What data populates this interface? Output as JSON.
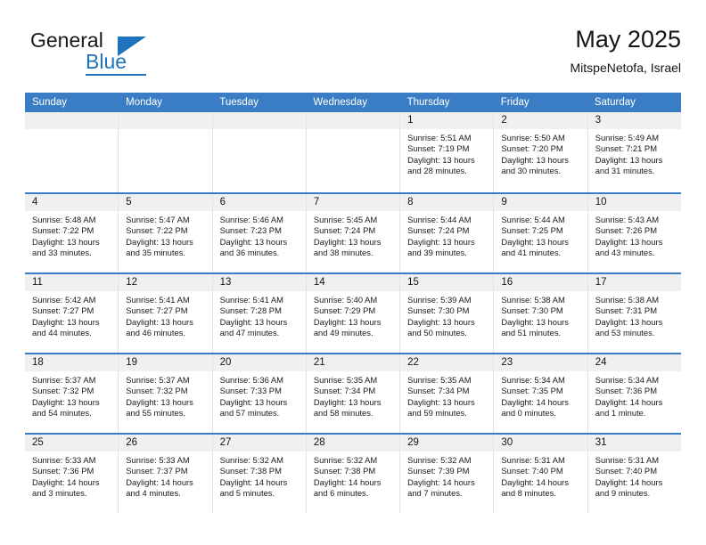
{
  "brand": {
    "name_part1": "General",
    "name_part2": "Blue",
    "accent_color": "#1F72BD"
  },
  "header": {
    "title": "May 2025",
    "subtitle": "MitspeNetofa, Israel"
  },
  "calendar": {
    "header_color": "#3B7DC4",
    "weekdays": [
      "Sunday",
      "Monday",
      "Tuesday",
      "Wednesday",
      "Thursday",
      "Friday",
      "Saturday"
    ],
    "weeks": [
      [
        {
          "day": "",
          "lines": []
        },
        {
          "day": "",
          "lines": []
        },
        {
          "day": "",
          "lines": []
        },
        {
          "day": "",
          "lines": []
        },
        {
          "day": "1",
          "lines": [
            "Sunrise: 5:51 AM",
            "Sunset: 7:19 PM",
            "Daylight: 13 hours",
            "and 28 minutes."
          ]
        },
        {
          "day": "2",
          "lines": [
            "Sunrise: 5:50 AM",
            "Sunset: 7:20 PM",
            "Daylight: 13 hours",
            "and 30 minutes."
          ]
        },
        {
          "day": "3",
          "lines": [
            "Sunrise: 5:49 AM",
            "Sunset: 7:21 PM",
            "Daylight: 13 hours",
            "and 31 minutes."
          ]
        }
      ],
      [
        {
          "day": "4",
          "lines": [
            "Sunrise: 5:48 AM",
            "Sunset: 7:22 PM",
            "Daylight: 13 hours",
            "and 33 minutes."
          ]
        },
        {
          "day": "5",
          "lines": [
            "Sunrise: 5:47 AM",
            "Sunset: 7:22 PM",
            "Daylight: 13 hours",
            "and 35 minutes."
          ]
        },
        {
          "day": "6",
          "lines": [
            "Sunrise: 5:46 AM",
            "Sunset: 7:23 PM",
            "Daylight: 13 hours",
            "and 36 minutes."
          ]
        },
        {
          "day": "7",
          "lines": [
            "Sunrise: 5:45 AM",
            "Sunset: 7:24 PM",
            "Daylight: 13 hours",
            "and 38 minutes."
          ]
        },
        {
          "day": "8",
          "lines": [
            "Sunrise: 5:44 AM",
            "Sunset: 7:24 PM",
            "Daylight: 13 hours",
            "and 39 minutes."
          ]
        },
        {
          "day": "9",
          "lines": [
            "Sunrise: 5:44 AM",
            "Sunset: 7:25 PM",
            "Daylight: 13 hours",
            "and 41 minutes."
          ]
        },
        {
          "day": "10",
          "lines": [
            "Sunrise: 5:43 AM",
            "Sunset: 7:26 PM",
            "Daylight: 13 hours",
            "and 43 minutes."
          ]
        }
      ],
      [
        {
          "day": "11",
          "lines": [
            "Sunrise: 5:42 AM",
            "Sunset: 7:27 PM",
            "Daylight: 13 hours",
            "and 44 minutes."
          ]
        },
        {
          "day": "12",
          "lines": [
            "Sunrise: 5:41 AM",
            "Sunset: 7:27 PM",
            "Daylight: 13 hours",
            "and 46 minutes."
          ]
        },
        {
          "day": "13",
          "lines": [
            "Sunrise: 5:41 AM",
            "Sunset: 7:28 PM",
            "Daylight: 13 hours",
            "and 47 minutes."
          ]
        },
        {
          "day": "14",
          "lines": [
            "Sunrise: 5:40 AM",
            "Sunset: 7:29 PM",
            "Daylight: 13 hours",
            "and 49 minutes."
          ]
        },
        {
          "day": "15",
          "lines": [
            "Sunrise: 5:39 AM",
            "Sunset: 7:30 PM",
            "Daylight: 13 hours",
            "and 50 minutes."
          ]
        },
        {
          "day": "16",
          "lines": [
            "Sunrise: 5:38 AM",
            "Sunset: 7:30 PM",
            "Daylight: 13 hours",
            "and 51 minutes."
          ]
        },
        {
          "day": "17",
          "lines": [
            "Sunrise: 5:38 AM",
            "Sunset: 7:31 PM",
            "Daylight: 13 hours",
            "and 53 minutes."
          ]
        }
      ],
      [
        {
          "day": "18",
          "lines": [
            "Sunrise: 5:37 AM",
            "Sunset: 7:32 PM",
            "Daylight: 13 hours",
            "and 54 minutes."
          ]
        },
        {
          "day": "19",
          "lines": [
            "Sunrise: 5:37 AM",
            "Sunset: 7:32 PM",
            "Daylight: 13 hours",
            "and 55 minutes."
          ]
        },
        {
          "day": "20",
          "lines": [
            "Sunrise: 5:36 AM",
            "Sunset: 7:33 PM",
            "Daylight: 13 hours",
            "and 57 minutes."
          ]
        },
        {
          "day": "21",
          "lines": [
            "Sunrise: 5:35 AM",
            "Sunset: 7:34 PM",
            "Daylight: 13 hours",
            "and 58 minutes."
          ]
        },
        {
          "day": "22",
          "lines": [
            "Sunrise: 5:35 AM",
            "Sunset: 7:34 PM",
            "Daylight: 13 hours",
            "and 59 minutes."
          ]
        },
        {
          "day": "23",
          "lines": [
            "Sunrise: 5:34 AM",
            "Sunset: 7:35 PM",
            "Daylight: 14 hours",
            "and 0 minutes."
          ]
        },
        {
          "day": "24",
          "lines": [
            "Sunrise: 5:34 AM",
            "Sunset: 7:36 PM",
            "Daylight: 14 hours",
            "and 1 minute."
          ]
        }
      ],
      [
        {
          "day": "25",
          "lines": [
            "Sunrise: 5:33 AM",
            "Sunset: 7:36 PM",
            "Daylight: 14 hours",
            "and 3 minutes."
          ]
        },
        {
          "day": "26",
          "lines": [
            "Sunrise: 5:33 AM",
            "Sunset: 7:37 PM",
            "Daylight: 14 hours",
            "and 4 minutes."
          ]
        },
        {
          "day": "27",
          "lines": [
            "Sunrise: 5:32 AM",
            "Sunset: 7:38 PM",
            "Daylight: 14 hours",
            "and 5 minutes."
          ]
        },
        {
          "day": "28",
          "lines": [
            "Sunrise: 5:32 AM",
            "Sunset: 7:38 PM",
            "Daylight: 14 hours",
            "and 6 minutes."
          ]
        },
        {
          "day": "29",
          "lines": [
            "Sunrise: 5:32 AM",
            "Sunset: 7:39 PM",
            "Daylight: 14 hours",
            "and 7 minutes."
          ]
        },
        {
          "day": "30",
          "lines": [
            "Sunrise: 5:31 AM",
            "Sunset: 7:40 PM",
            "Daylight: 14 hours",
            "and 8 minutes."
          ]
        },
        {
          "day": "31",
          "lines": [
            "Sunrise: 5:31 AM",
            "Sunset: 7:40 PM",
            "Daylight: 14 hours",
            "and 9 minutes."
          ]
        }
      ]
    ]
  }
}
